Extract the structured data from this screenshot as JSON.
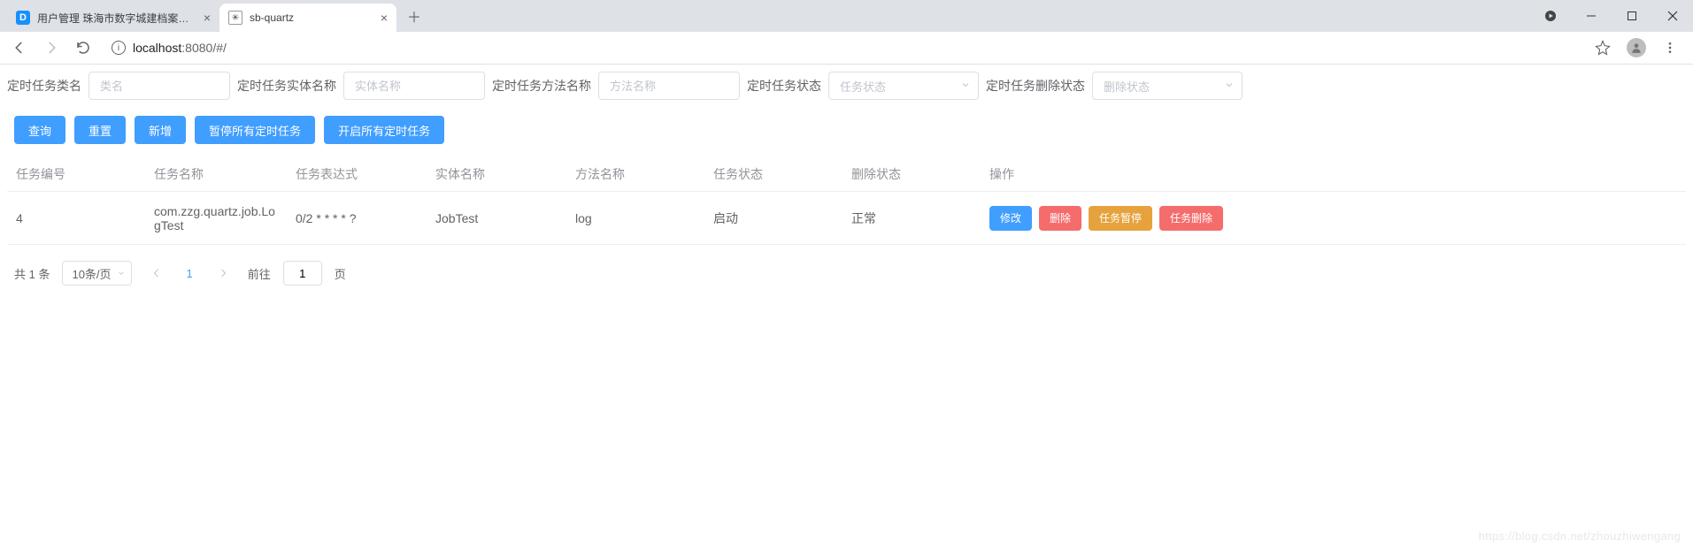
{
  "browser": {
    "tabs": [
      {
        "title": "用户管理 珠海市数字城建档案管…",
        "active": false
      },
      {
        "title": "sb-quartz",
        "active": true
      }
    ],
    "url_host": "localhost",
    "url_port": ":8080",
    "url_path": "/#/"
  },
  "filters": {
    "class_label": "定时任务类名",
    "class_placeholder": "类名",
    "entity_label": "定时任务实体名称",
    "entity_placeholder": "实体名称",
    "method_label": "定时任务方法名称",
    "method_placeholder": "方法名称",
    "status_label": "定时任务状态",
    "status_placeholder": "任务状态",
    "delete_status_label": "定时任务删除状态",
    "delete_status_placeholder": "删除状态"
  },
  "buttons": {
    "query": "查询",
    "reset": "重置",
    "add": "新增",
    "pause_all": "暂停所有定时任务",
    "start_all": "开启所有定时任务"
  },
  "table": {
    "headers": {
      "id": "任务编号",
      "name": "任务名称",
      "expr": "任务表达式",
      "entity": "实体名称",
      "method": "方法名称",
      "status": "任务状态",
      "delstatus": "删除状态",
      "ops": "操作"
    },
    "rows": [
      {
        "id": "4",
        "name": "com.zzg.quartz.job.LogTest",
        "expr": "0/2 * * * * ?",
        "entity": "JobTest",
        "method": "log",
        "status": "启动",
        "delstatus": "正常"
      }
    ],
    "ops": {
      "edit": "修改",
      "delete": "删除",
      "pause": "任务暂停",
      "remove": "任务删除"
    }
  },
  "pagination": {
    "total_text": "共 1 条",
    "page_size": "10条/页",
    "current": "1",
    "jump_prefix": "前往",
    "jump_value": "1",
    "jump_suffix": "页"
  },
  "watermark": "https://blog.csdn.net/zhouzhiwengang"
}
